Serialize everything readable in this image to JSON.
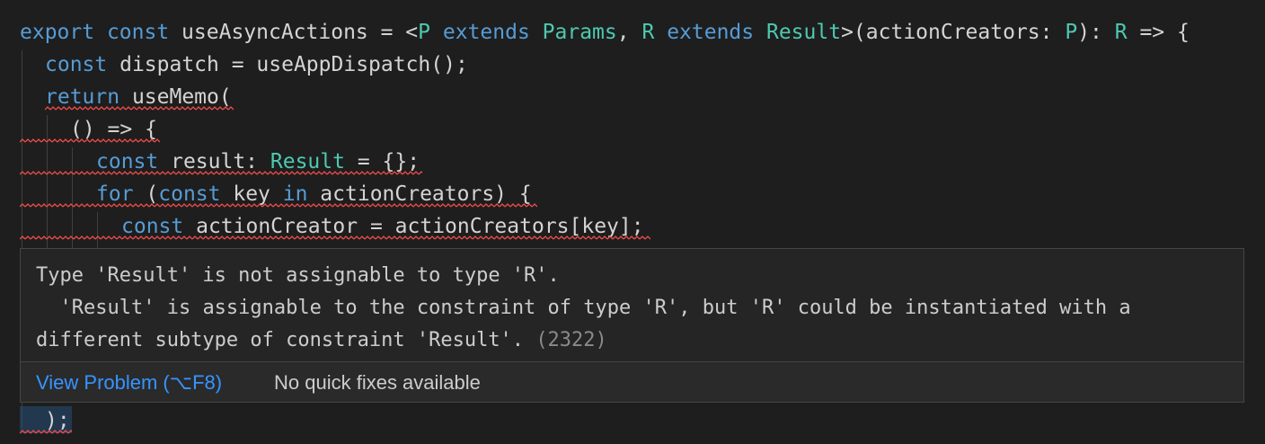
{
  "code_lines": [
    "export const useAsyncActions = <P extends Params, R extends Result>(actionCreators: P): R => {",
    "  const dispatch = useAppDispatch();",
    "  return useMemo(",
    "    () => {",
    "      const result: Result = {};",
    "      for (const key in actionCreators) {",
    "        const actionCreator = actionCreators[key];",
    "  );"
  ],
  "tokens": {
    "export": "export",
    "const": "const",
    "useAsyncActions": " useAsyncActions = <",
    "P": "P",
    "extends": "extends",
    "Params": "Params",
    "R": "R",
    "Result": "Result",
    "actionCreators_param": ">(actionCreators: ",
    "after_P": "): ",
    "arrow": " => {",
    "dispatch": " dispatch = useAppDispatch();",
    "return": "return",
    "useMemo": " useMemo(",
    "arrow_fn": "() => {",
    "result_decl": " result: ",
    "result_init": " = {};",
    "for": "for",
    "paren_open": " (",
    "key": " key ",
    "in": "in",
    "loop_tail": " actionCreators) {",
    "actionCreator": " actionCreator = actionCreators[key];",
    "close_paren": ");"
  },
  "hover": {
    "message_line1": "Type 'Result' is not assignable to type 'R'.",
    "message_line2": "  'Result' is assignable to the constraint of type 'R', but 'R' could be instantiated with a",
    "message_line3": "different subtype of constraint 'Result'.",
    "error_code": "(2322)",
    "view_problem": "View Problem (⌥F8)",
    "no_quick_fixes": "No quick fixes available"
  },
  "colors": {
    "background": "#1e1e1e",
    "keyword": "#569cd6",
    "type": "#4ec9b0",
    "text": "#d4d4d4",
    "error_squiggle": "#f14c4c",
    "link": "#3794ff"
  }
}
